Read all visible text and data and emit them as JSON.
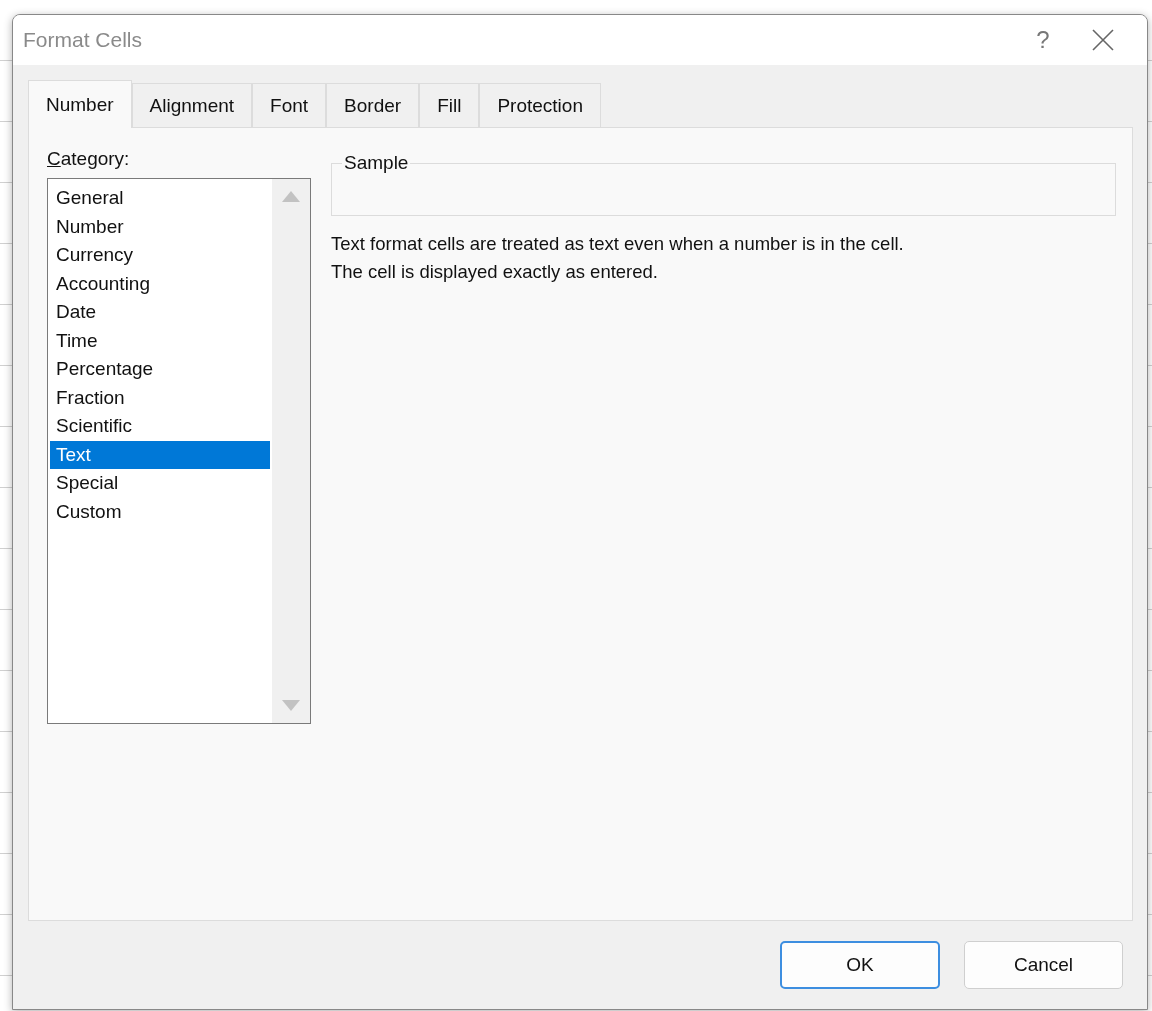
{
  "window": {
    "title": "Format Cells",
    "help": "?"
  },
  "tabs": [
    {
      "label": "Number",
      "selected": true
    },
    {
      "label": "Alignment",
      "selected": false
    },
    {
      "label": "Font",
      "selected": false
    },
    {
      "label": "Border",
      "selected": false
    },
    {
      "label": "Fill",
      "selected": false
    },
    {
      "label": "Protection",
      "selected": false
    }
  ],
  "category": {
    "label": "Category:",
    "items": [
      {
        "label": "General",
        "selected": false
      },
      {
        "label": "Number",
        "selected": false
      },
      {
        "label": "Currency",
        "selected": false
      },
      {
        "label": "Accounting",
        "selected": false
      },
      {
        "label": "Date",
        "selected": false
      },
      {
        "label": "Time",
        "selected": false
      },
      {
        "label": "Percentage",
        "selected": false
      },
      {
        "label": "Fraction",
        "selected": false
      },
      {
        "label": "Scientific",
        "selected": false
      },
      {
        "label": "Text",
        "selected": true
      },
      {
        "label": "Special",
        "selected": false
      },
      {
        "label": "Custom",
        "selected": false
      }
    ]
  },
  "sample": {
    "label": "Sample"
  },
  "description": [
    "Text format cells are treated as text even when a number is in the cell.",
    "The cell is displayed exactly as entered."
  ],
  "buttons": [
    {
      "label": "OK",
      "default": true
    },
    {
      "label": "Cancel",
      "default": false
    }
  ]
}
